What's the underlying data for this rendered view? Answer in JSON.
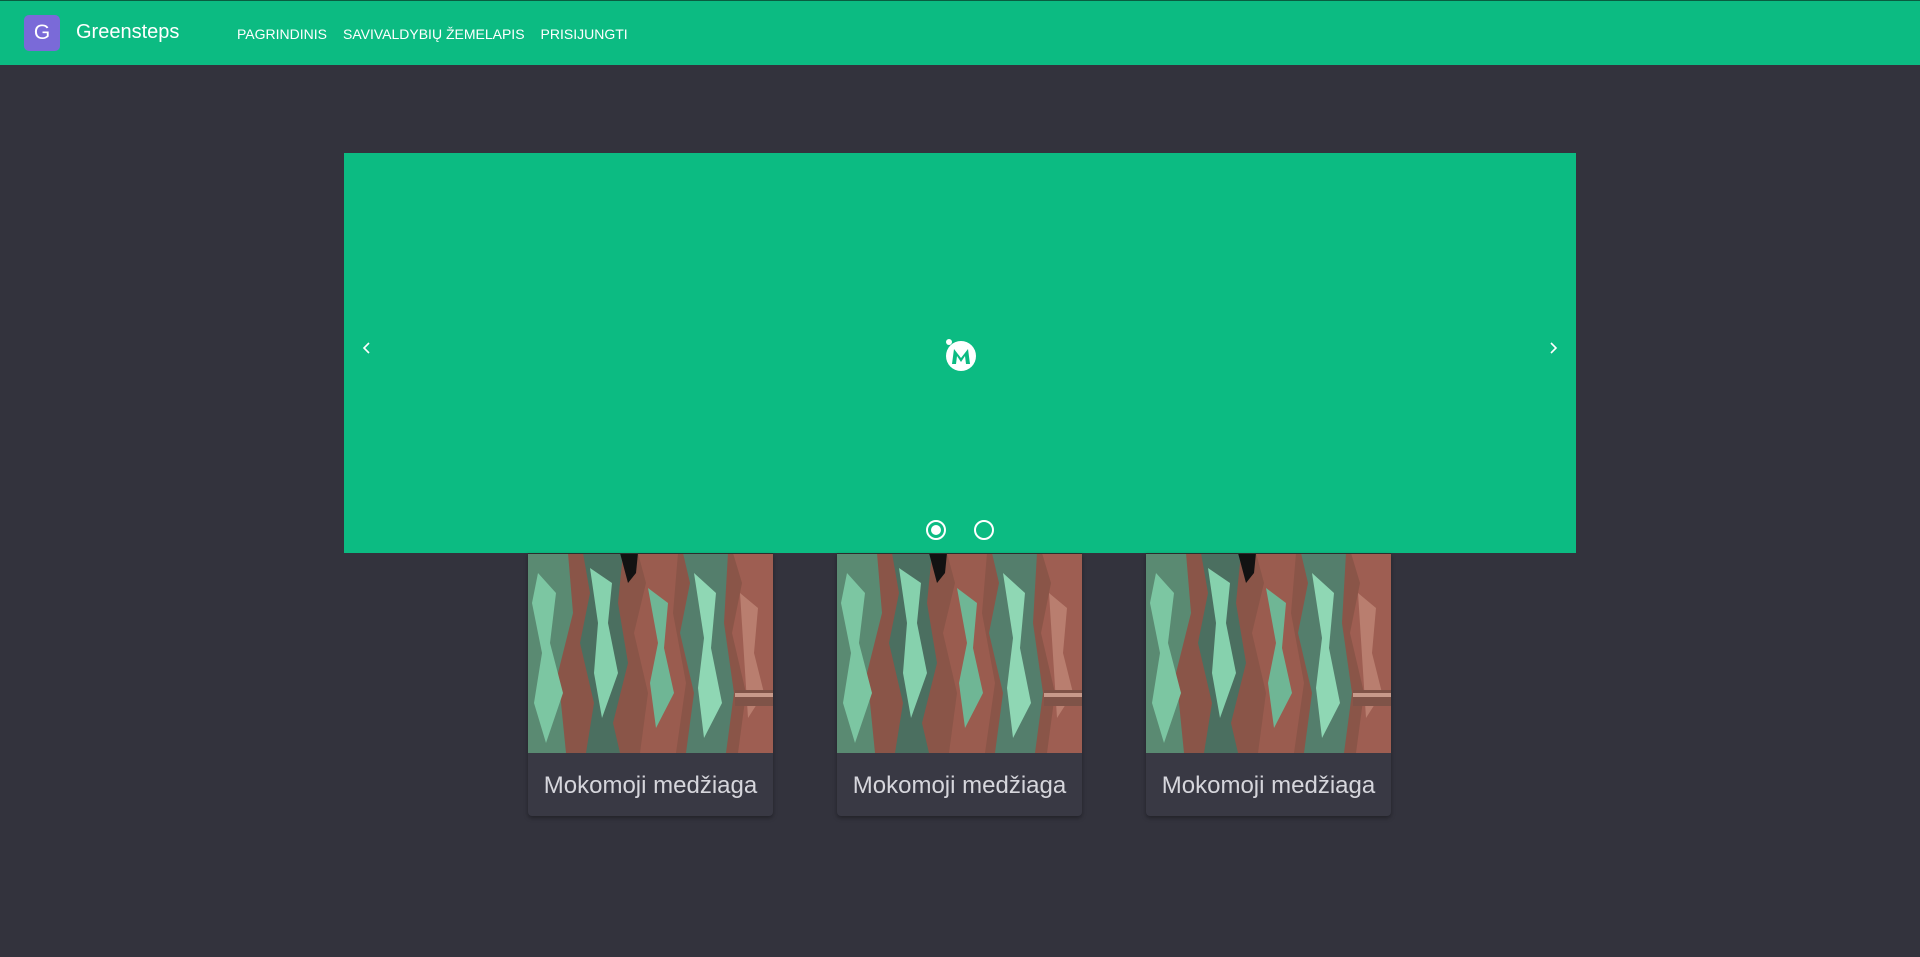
{
  "app": {
    "brand_initial": "G",
    "brand_name": "Greensteps",
    "accent_color": "#0cbb82",
    "background_color": "#33333d"
  },
  "nav": {
    "items": [
      {
        "label": "PAGRINDINIS"
      },
      {
        "label": "SAVIVALDYBIŲ ŽEMELAPIS"
      },
      {
        "label": "PRISIJUNGTI"
      }
    ]
  },
  "carousel": {
    "slide_icon": "broken-image-icon",
    "prev_icon": "chevron-left-icon",
    "next_icon": "chevron-right-icon",
    "slide_count": 2,
    "active_slide": 1
  },
  "cards": [
    {
      "title": "Mokomoji medžiaga",
      "image": "peeling-paint-wood-photo"
    },
    {
      "title": "Mokomoji medžiaga",
      "image": "peeling-paint-wood-photo"
    },
    {
      "title": "Mokomoji medžiaga",
      "image": "peeling-paint-wood-photo"
    }
  ]
}
